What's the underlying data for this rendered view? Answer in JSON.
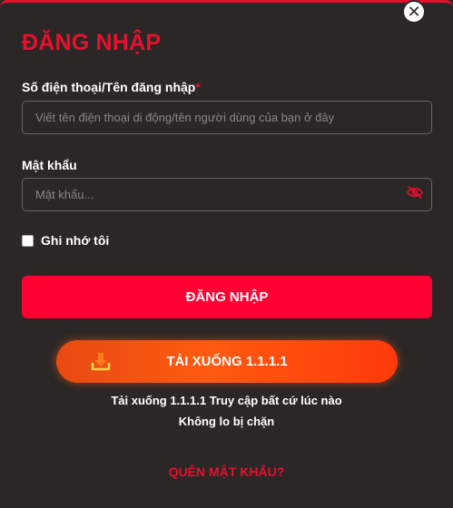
{
  "modal": {
    "title": "ĐĂNG NHẬP",
    "close_icon": "close-icon",
    "accent_color": "#e8112d"
  },
  "username": {
    "label": "Số điện thoại/Tên đăng nhập",
    "required_mark": "*",
    "placeholder": "Viết tên điện thoại di động/tên người dùng của bạn ở đây",
    "value": ""
  },
  "password": {
    "label": "Mật khẩu",
    "placeholder": "Mật khẩu...",
    "value": "",
    "toggle_icon": "eye-slash-icon"
  },
  "remember": {
    "label": "Ghi nhớ tôi",
    "checked": false
  },
  "login_button": {
    "label": "ĐĂNG NHẬP",
    "color": "#ff0033"
  },
  "download_button": {
    "label": "TẢI XUỐNG 1.1.1.1",
    "icon": "download-icon"
  },
  "promo": {
    "line1": "Tải xuống 1.1.1.1 Truy cập bất cứ lúc nào",
    "line2": "Không lo bị chặn"
  },
  "forgot_password": {
    "label": "QUÊN MẬT KHẨU?"
  }
}
